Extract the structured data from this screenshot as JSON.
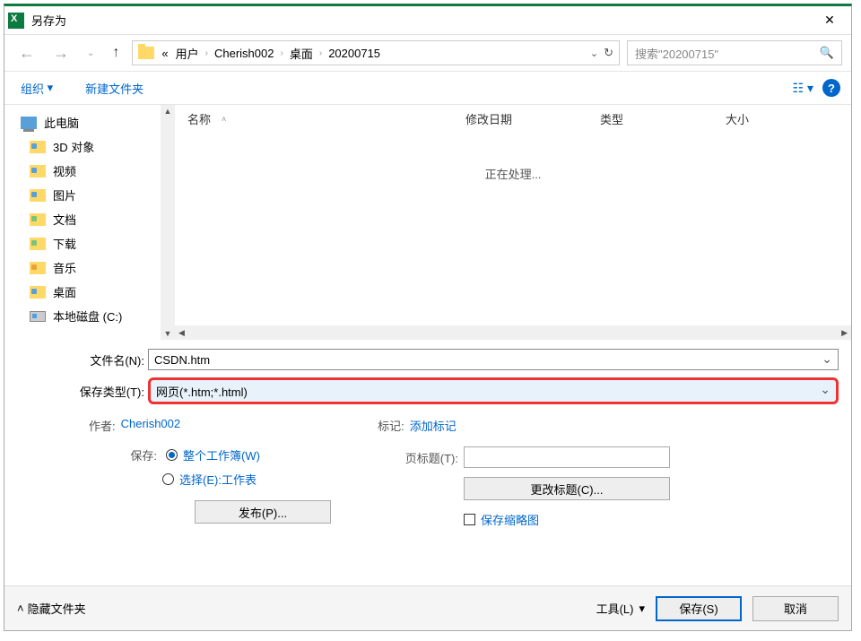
{
  "title": "另存为",
  "path": {
    "prefix": "«",
    "segments": [
      "用户",
      "Cherish002",
      "桌面",
      "20200715"
    ]
  },
  "search": {
    "placeholder": "搜索\"20200715\""
  },
  "toolbar": {
    "organize": "组织",
    "new_folder": "新建文件夹"
  },
  "tree": {
    "root": "此电脑",
    "items": [
      "3D 对象",
      "视频",
      "图片",
      "文档",
      "下载",
      "音乐",
      "桌面",
      "本地磁盘 (C:)"
    ]
  },
  "columns": {
    "name": "名称",
    "date": "修改日期",
    "type": "类型",
    "size": "大小"
  },
  "processing": "正在处理...",
  "form": {
    "filename_label": "文件名(N):",
    "filename_value": "CSDN.htm",
    "filetype_label": "保存类型(T):",
    "filetype_value": "网页(*.htm;*.html)"
  },
  "meta": {
    "author_label": "作者:",
    "author_value": "Cherish002",
    "tag_label": "标记:",
    "tag_value": "添加标记"
  },
  "save_opts": {
    "save_label": "保存:",
    "whole_workbook": "整个工作簿(W)",
    "selection": "选择(E):工作表",
    "publish": "发布(P)...",
    "page_title_label": "页标题(T):",
    "change_title": "更改标题(C)...",
    "thumbnail": "保存缩略图"
  },
  "footer": {
    "hide_folders": "隐藏文件夹",
    "tools": "工具(L)",
    "save": "保存(S)",
    "cancel": "取消"
  }
}
